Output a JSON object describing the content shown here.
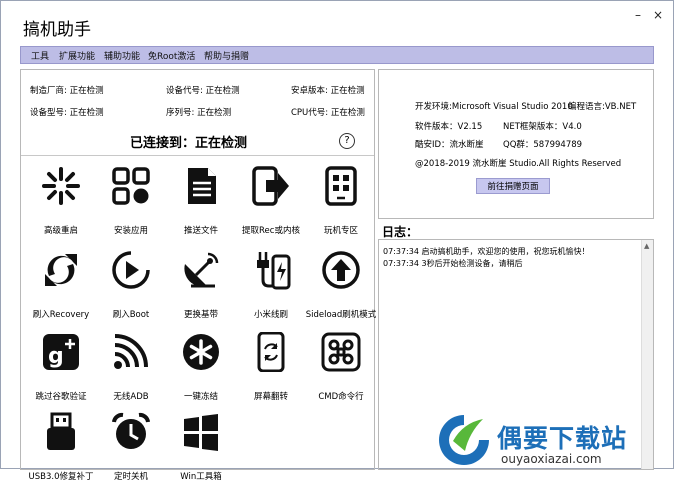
{
  "window": {
    "title": "搞机助手",
    "minimize_glyph": "–",
    "close_glyph": "×"
  },
  "menu": [
    "工具",
    "扩展功能",
    "辅助功能",
    "免Root激活",
    "帮助与捐赠"
  ],
  "device_info": {
    "manufacturer": "制造厂商: 正在检测",
    "device_code": "设备代号: 正在检测",
    "android_version": "安卓版本: 正在检测",
    "model": "设备型号: 正在检测",
    "serial": "序列号: 正在检测",
    "cpu": "CPU代号: 正在检测"
  },
  "connection": {
    "status": "已连接到：正在检测",
    "help_glyph": "?"
  },
  "tools": [
    {
      "label": "高级重启",
      "icon": "advanced-reboot-icon"
    },
    {
      "label": "安装应用",
      "icon": "install-app-icon"
    },
    {
      "label": "推送文件",
      "icon": "push-file-icon"
    },
    {
      "label": "提取Rec或内核",
      "icon": "extract-rec-kernel-icon"
    },
    {
      "label": "玩机专区",
      "icon": "phone-zone-icon"
    },
    {
      "label": "刷入Recovery",
      "icon": "flash-recovery-icon"
    },
    {
      "label": "刷入Boot",
      "icon": "flash-boot-icon"
    },
    {
      "label": "更换基带",
      "icon": "satellite-dish-icon"
    },
    {
      "label": "小米线刷",
      "icon": "xiaomi-line-flash-icon"
    },
    {
      "label": "Sideload刷机模式",
      "icon": "sideload-icon"
    },
    {
      "label": "跳过谷歌验证",
      "icon": "google-plus-icon"
    },
    {
      "label": "无线ADB",
      "icon": "wireless-adb-icon"
    },
    {
      "label": "一键冻结",
      "icon": "freeze-icon"
    },
    {
      "label": "屏幕翻转",
      "icon": "screen-rotate-icon"
    },
    {
      "label": "CMD命令行",
      "icon": "cmd-icon"
    },
    {
      "label": "USB3.0修复补丁",
      "icon": "usb-patch-icon"
    },
    {
      "label": "定时关机",
      "icon": "alarm-clock-icon"
    },
    {
      "label": "Win工具箱",
      "icon": "windows-icon"
    }
  ],
  "about": {
    "env": "开发环境:Microsoft Visual Studio 2010",
    "lang": "编程语言:VB.NET",
    "version": "软件版本：V2.15",
    "net": "NET框架版本：V4.0",
    "cool_id": "酷安ID：流水断崖",
    "qq": "QQ群：587994789",
    "copyright": "@2018-2019  流水断崖 Studio.All Rights Reserved",
    "button": "前往捐赠页面"
  },
  "log": {
    "label": "日志：",
    "lines": [
      "07:37:34 启动搞机助手，欢迎您的使用，祝您玩机愉快！",
      "07:37:34 3秒后开始检测设备，请稍后"
    ]
  },
  "watermark": {
    "brand": "偶要下载站",
    "url": "ouyaoxiazai.com"
  },
  "colors": {
    "menu_bg": "#bdbde6",
    "button_bg": "#c7c7ef",
    "watermark_blue": "#1d6fb8",
    "watermark_green": "#58b83a"
  }
}
